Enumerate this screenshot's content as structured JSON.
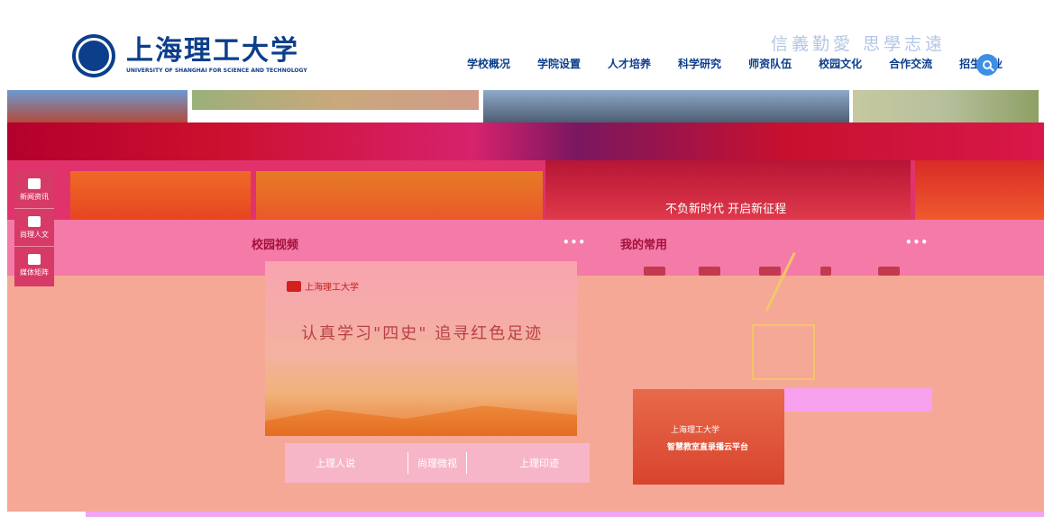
{
  "header": {
    "logo_cn": "上海理工大学",
    "logo_en": "UNIVERSITY OF SHANGHAI FOR SCIENCE AND TECHNOLOGY",
    "motto": "信義勤愛 思學志遠",
    "nav": [
      "学校概况",
      "学院设置",
      "人才培养",
      "科学研究",
      "师资队伍",
      "校园文化",
      "合作交流",
      "招生就业"
    ],
    "search_icon": "search-icon"
  },
  "banner": {
    "caption": "不负新时代 开启新征程"
  },
  "sidebar": {
    "items": [
      {
        "label": "新闻资讯",
        "icon": "newspaper-icon"
      },
      {
        "label": "尚理人文",
        "icon": "book-icon"
      },
      {
        "label": "媒体矩阵",
        "icon": "megaphone-icon"
      }
    ]
  },
  "video_section": {
    "title": "校园视频",
    "more": "•••",
    "badge": "上海理工大学",
    "video_title": "认真学习\"四史\" 追寻红色足迹",
    "tabs": [
      "上理人说",
      "尚理微视",
      "上理印迹"
    ]
  },
  "common_section": {
    "title": "我的常用",
    "more": "•••",
    "cloud_logo": "上海理工大学",
    "cloud_text": "智慧教室直录播云平台"
  },
  "colors": {
    "brand": "#0d3e8c",
    "accent": "#3d8fe6"
  }
}
